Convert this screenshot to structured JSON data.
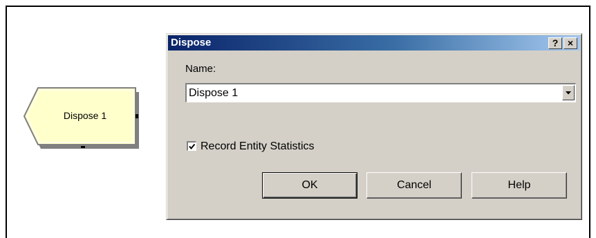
{
  "module": {
    "label": "Dispose 1",
    "fill_color": "#ffffcc"
  },
  "dialog": {
    "title": "Dispose",
    "title_buttons": {
      "help": "?",
      "close": "×"
    },
    "name_label": "Name:",
    "name_value": "Dispose 1",
    "record_stats": {
      "label": "Record Entity Statistics",
      "checked": true
    },
    "buttons": {
      "ok": "OK",
      "cancel": "Cancel",
      "help": "Help"
    }
  },
  "colors": {
    "titlebar_start": "#0a246a",
    "titlebar_end": "#a6caf0",
    "dialog_face": "#d4d0c8"
  }
}
